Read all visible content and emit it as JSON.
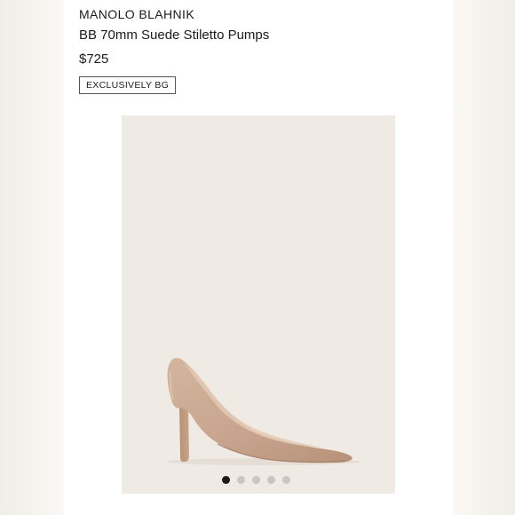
{
  "product": {
    "brand": "MANOLO BLAHNIK",
    "title": "BB 70mm Suede Stiletto Pumps",
    "price": "$725",
    "badge": "EXCLUSIVELY BG"
  },
  "gallery": {
    "image_label": "shoe",
    "dots_total": 5,
    "active_index": 1
  },
  "colors": {
    "suede": "#c9a892",
    "background": "#efebe4",
    "active_dot": "#1a1a1a",
    "inactive_dot": "#c9c6c2"
  }
}
